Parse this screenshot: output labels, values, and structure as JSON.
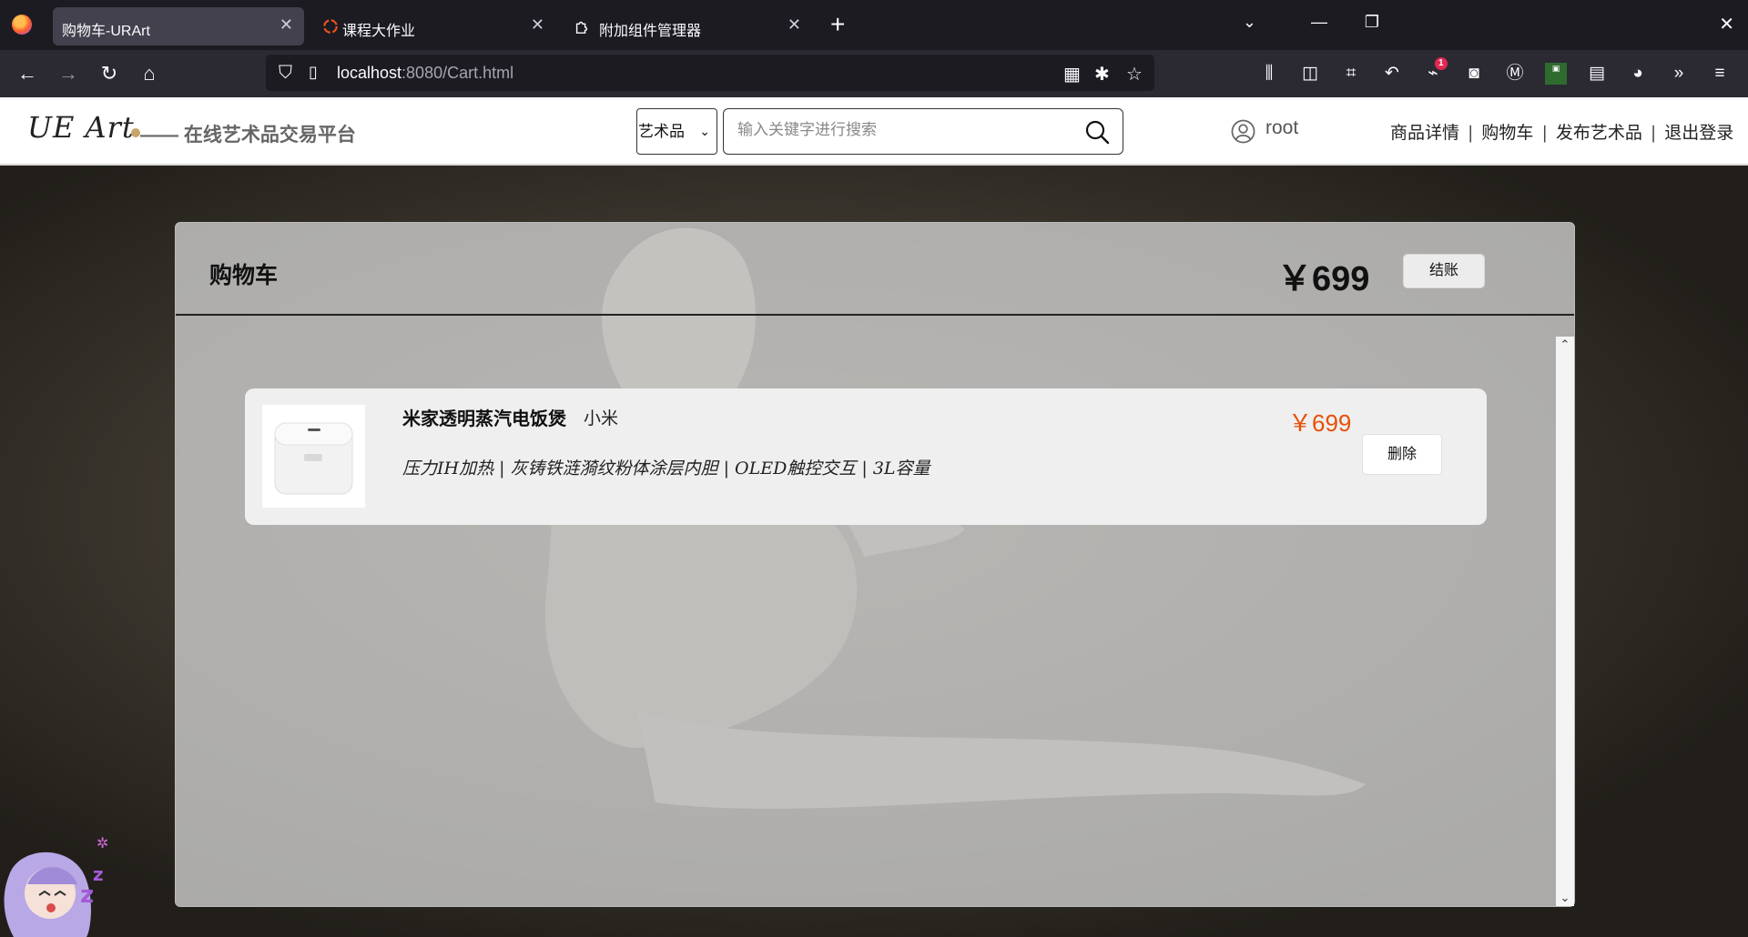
{
  "browser": {
    "tabs": [
      {
        "title": "购物车-URArt",
        "active": true,
        "icon": "firefox-page-icon"
      },
      {
        "title": "课程大作业",
        "active": false,
        "icon": "ubuntu-icon"
      },
      {
        "title": "附加组件管理器",
        "active": false,
        "icon": "puzzle-icon"
      }
    ],
    "url_host": "localhost",
    "url_rest": ":8080/Cart.html",
    "extension_badge": "1"
  },
  "header": {
    "logo_text": "UE Art",
    "slogan": "—— 在线艺术品交易平台",
    "category_selected": "艺术品",
    "search_placeholder": "输入关键字进行搜索",
    "username": "root",
    "links": [
      "商品详情",
      "购物车",
      "发布艺术品",
      "退出登录"
    ]
  },
  "cart": {
    "title": "购物车",
    "total": "￥699",
    "checkout_label": "结账",
    "items": [
      {
        "name": "米家透明蒸汽电饭煲",
        "brand": "小米",
        "description": "压力IH加热 | 灰铸铁涟漪纹粉体涂层内胆 | OLED触控交互 | 3L容量",
        "price": "￥699",
        "delete_label": "删除"
      }
    ]
  },
  "colors": {
    "price_accent": "#e8500a",
    "chrome_dark": "#1c1b22",
    "toolbar": "#2b2a33"
  }
}
